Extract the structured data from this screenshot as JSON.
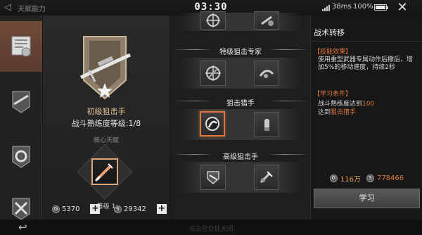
{
  "status_bar": {
    "title": "天赋能力",
    "time": "03:30",
    "ping": "38ms",
    "battery": "100%",
    "battery_level": 1.0
  },
  "rail": {
    "tabs": [
      {
        "icon": "certificate-icon",
        "active": true
      },
      {
        "icon": "sniper-badge-icon",
        "active": false
      },
      {
        "icon": "gear-badge-icon",
        "active": false
      },
      {
        "icon": "cross-badge-icon",
        "active": false
      }
    ]
  },
  "skill": {
    "name": "初级狙击手",
    "proficiency": "战斗熟练度等级:1/8",
    "core_label": "核心天赋",
    "level": "等级 1"
  },
  "resources": {
    "gold_label": "G",
    "gold_value": "5370",
    "silver_label": "S",
    "silver_value": "29342"
  },
  "tree": {
    "tier1_title": "特级狙击专家",
    "tier2_title": "狙击猎手",
    "tier3_title": "高级狙击手",
    "nodes": [
      {
        "icon": "crosshair-icon"
      },
      {
        "icon": "reload-icon"
      },
      {
        "icon": "target-icon"
      },
      {
        "icon": "bullet-icon"
      },
      {
        "icon": "shield-icon"
      },
      {
        "icon": "tool-icon"
      }
    ]
  },
  "detail": {
    "title": "战术转移",
    "effect_label": "【技能效果】",
    "effect_text": "使用重型武器专属动作后撤后，增加5%的移动速度，持续2秒",
    "condition_label": "【学习条件】",
    "condition_line1_prefix": "战斗熟练度达到",
    "condition_line1_value": "100",
    "condition_line2_prefix": "达到",
    "condition_line2_value": "狙击猎手",
    "cost_gold": "116万",
    "cost_silver": "778466",
    "learn_label": "学习"
  },
  "footer": {
    "hint": "点击空白处关闭"
  },
  "colors": {
    "accent": "#e0773a",
    "active_tab": "#6e4a39"
  }
}
